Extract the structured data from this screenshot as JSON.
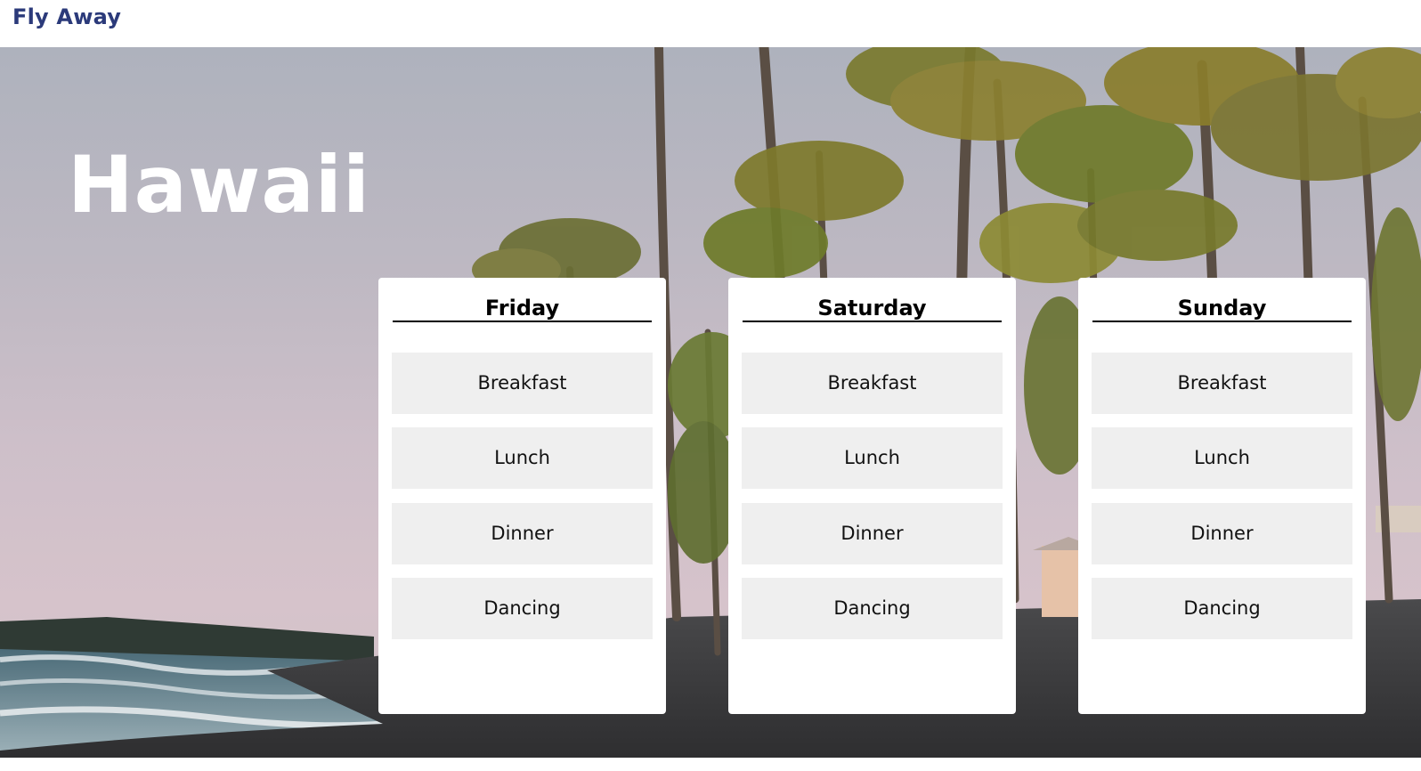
{
  "header": {
    "brand": "Fly Away",
    "brand_color": "#2b3a7a"
  },
  "hero": {
    "title": "Hawaii",
    "background_image": "tropical-beach-with-palm-trees"
  },
  "days": [
    {
      "name": "Friday",
      "activities": [
        "Breakfast",
        "Lunch",
        "Dinner",
        "Dancing"
      ]
    },
    {
      "name": "Saturday",
      "activities": [
        "Breakfast",
        "Lunch",
        "Dinner",
        "Dancing"
      ]
    },
    {
      "name": "Sunday",
      "activities": [
        "Breakfast",
        "Lunch",
        "Dinner",
        "Dancing"
      ]
    }
  ]
}
